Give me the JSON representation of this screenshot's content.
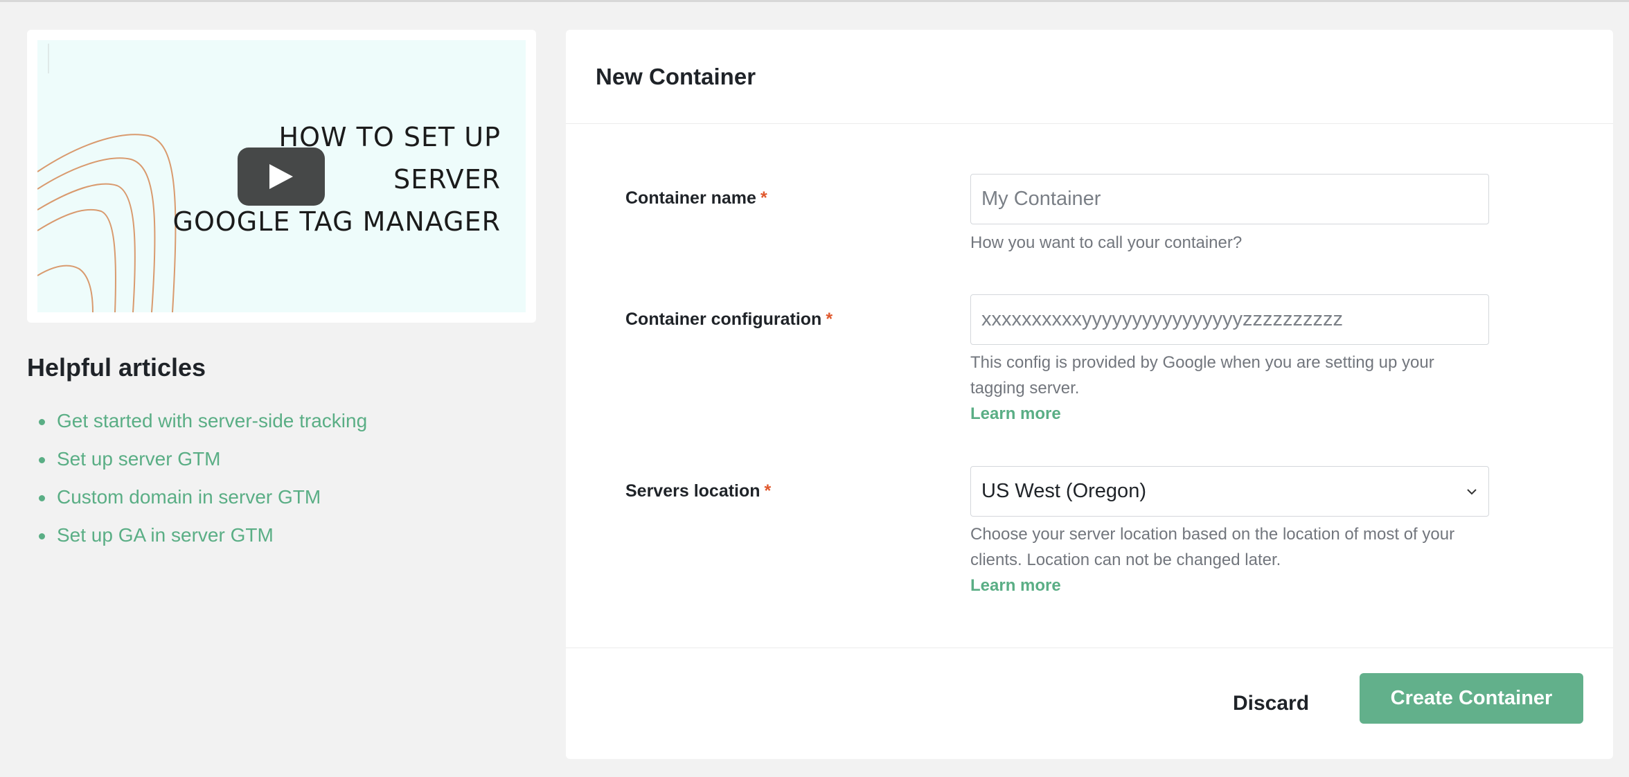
{
  "video": {
    "title_lines": [
      "HOW TO SET UP",
      "SERVER",
      "GOOGLE TAG MANAGER"
    ],
    "play_icon": "play-icon"
  },
  "articles": {
    "title": "Helpful articles",
    "items": [
      "Get started with server-side tracking",
      "Set up server GTM",
      "Custom domain in server GTM",
      "Set up GA in server GTM"
    ]
  },
  "form": {
    "title": "New Container",
    "required_mark": "*",
    "name": {
      "label": "Container name",
      "placeholder": "My Container",
      "help": "How you want to call your container?"
    },
    "config": {
      "label": "Container configuration",
      "placeholder": "xxxxxxxxxxyyyyyyyyyyyyyyyyzzzzzzzzzz",
      "help": "This config is provided by Google when you are setting up your tagging server.",
      "learn_more": "Learn more"
    },
    "location": {
      "label": "Servers location",
      "value": "US West (Oregon)",
      "help": "Choose your server location based on the location of most of your clients. Location can not be changed later.",
      "learn_more": "Learn more"
    }
  },
  "footer": {
    "discard_label": "Discard",
    "create_label": "Create Container"
  },
  "colors": {
    "accent": "#5aae85",
    "button": "#62b08b",
    "required": "#e0582d"
  }
}
